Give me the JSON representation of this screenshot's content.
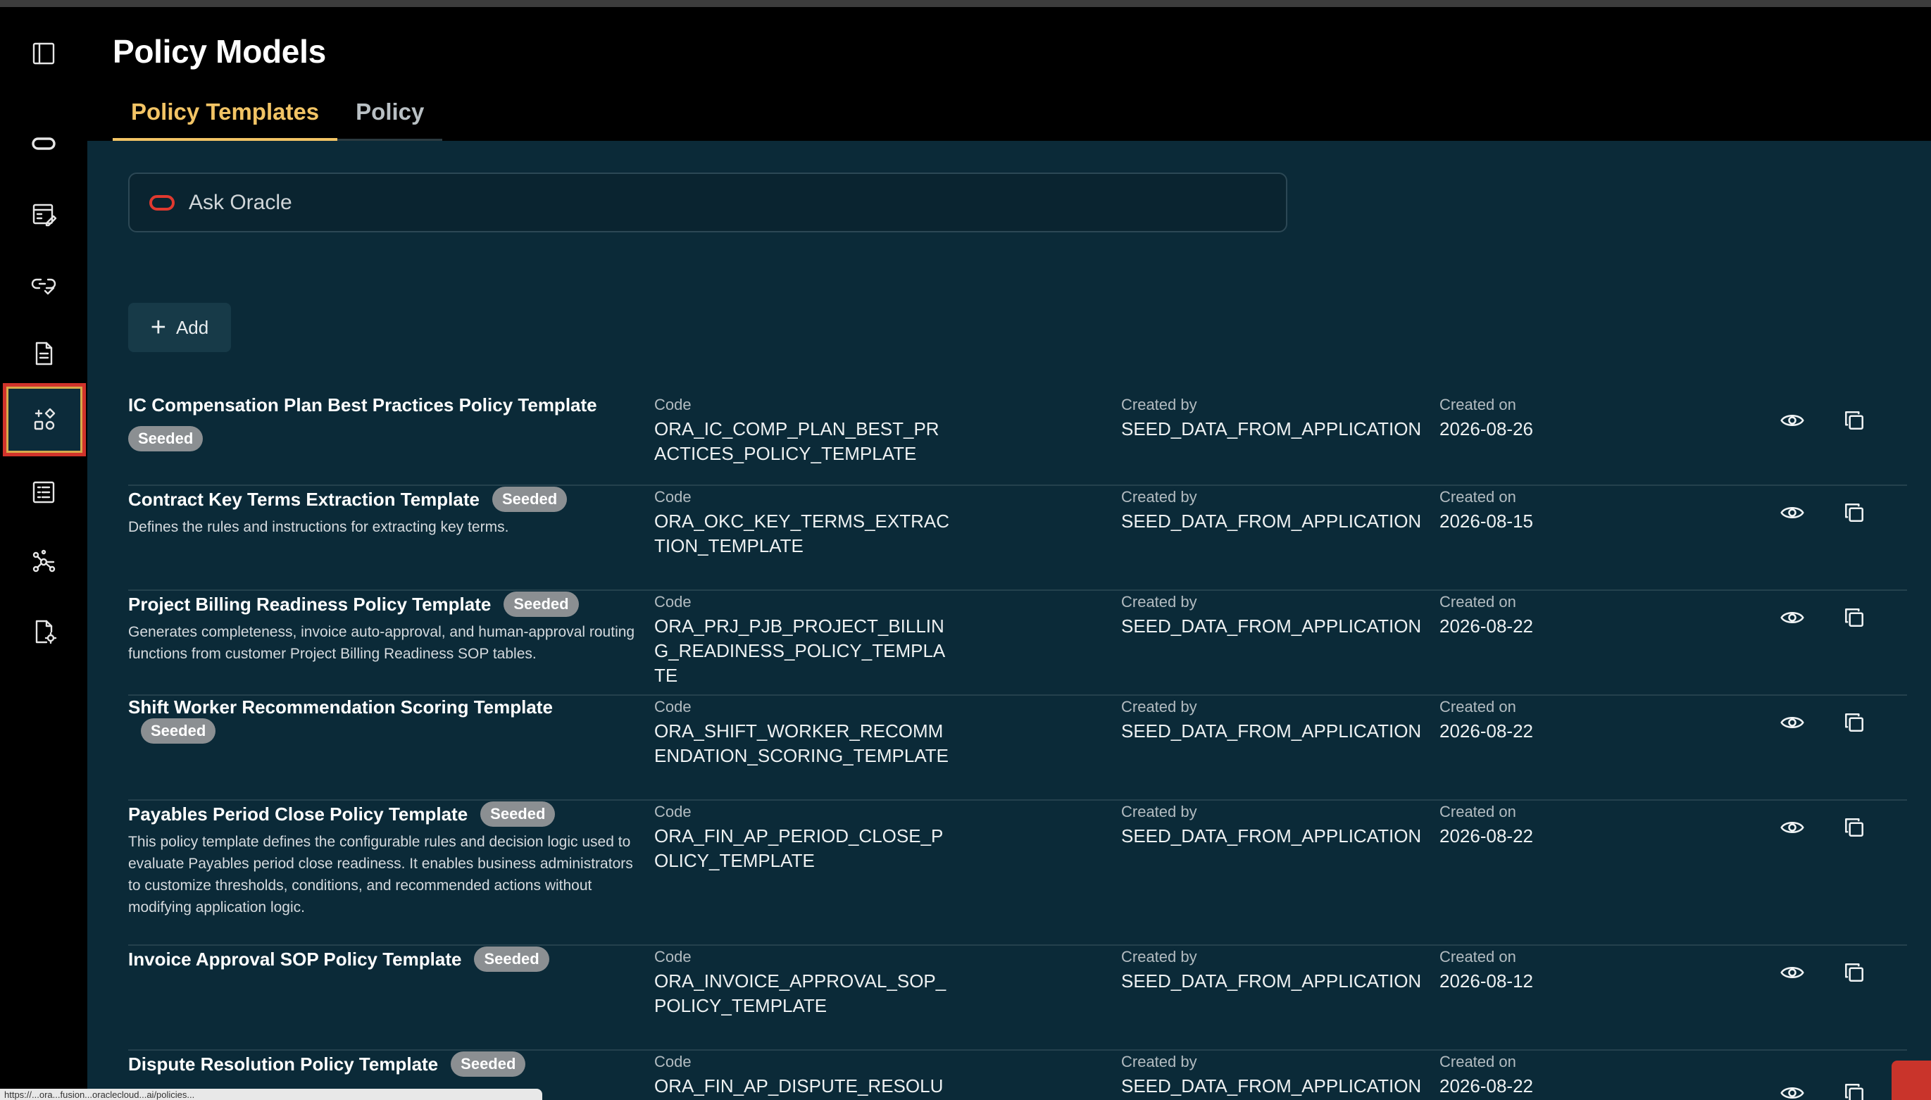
{
  "header": {
    "title": "Policy Models",
    "tabs": [
      {
        "label": "Policy Templates",
        "active": true
      },
      {
        "label": "Policy",
        "active": false
      }
    ]
  },
  "sidebar": {
    "items": [
      {
        "icon": "panel-toggle-icon"
      },
      {
        "icon": "oracle-logo-icon"
      },
      {
        "icon": "calendar-edit-icon"
      },
      {
        "icon": "link-check-icon"
      },
      {
        "icon": "document-icon"
      },
      {
        "icon": "policy-models-icon",
        "active": true
      },
      {
        "icon": "list-icon"
      },
      {
        "icon": "network-icon"
      },
      {
        "icon": "file-settings-icon"
      }
    ]
  },
  "search": {
    "placeholder": "Ask Oracle"
  },
  "toolbar": {
    "add_label": "Add"
  },
  "columns": {
    "code": "Code",
    "created_by": "Created by",
    "created_on": "Created on"
  },
  "badge_label": "Seeded",
  "rows": [
    {
      "name": "IC Compensation Plan Best Practices Policy Template",
      "description": "",
      "code": "ORA_IC_COMP_PLAN_BEST_PRACTICES_POLICY_TEMPLATE",
      "created_by": "SEED_DATA_FROM_APPLICATION",
      "created_on": "2026-08-26"
    },
    {
      "name": "Contract Key Terms Extraction Template",
      "description": "Defines the rules and instructions for extracting key terms.",
      "code": "ORA_OKC_KEY_TERMS_EXTRACTION_TEMPLATE",
      "created_by": "SEED_DATA_FROM_APPLICATION",
      "created_on": "2026-08-15"
    },
    {
      "name": "Project Billing Readiness Policy Template",
      "description": "Generates completeness, invoice auto-approval, and human-approval routing functions from customer Project Billing Readiness SOP tables.",
      "code": "ORA_PRJ_PJB_PROJECT_BILLING_READINESS_POLICY_TEMPLATE",
      "created_by": "SEED_DATA_FROM_APPLICATION",
      "created_on": "2026-08-22"
    },
    {
      "name": "Shift Worker Recommendation Scoring Template",
      "description": "",
      "code": "ORA_SHIFT_WORKER_RECOMMENDATION_SCORING_TEMPLATE",
      "created_by": "SEED_DATA_FROM_APPLICATION",
      "created_on": "2026-08-22"
    },
    {
      "name": "Payables Period Close Policy Template",
      "description": "This policy template defines the configurable rules and decision logic used to evaluate Payables period close readiness. It enables business administrators to customize thresholds, conditions, and recommended actions without modifying application logic.",
      "code": "ORA_FIN_AP_PERIOD_CLOSE_POLICY_TEMPLATE",
      "created_by": "SEED_DATA_FROM_APPLICATION",
      "created_on": "2026-08-22"
    },
    {
      "name": "Invoice Approval SOP Policy Template",
      "description": "",
      "code": "ORA_INVOICE_APPROVAL_SOP_POLICY_TEMPLATE",
      "created_by": "SEED_DATA_FROM_APPLICATION",
      "created_on": "2026-08-12"
    },
    {
      "name": "Dispute Resolution Policy Template",
      "description": "",
      "code": "ORA_FIN_AP_DISPUTE_RESOLUTI",
      "created_by": "SEED_DATA_FROM_APPLICATION",
      "created_on": "2026-08-22"
    }
  ],
  "status_bar": {
    "text": "https://...ora...fusion...oraclecloud...ai/policies..."
  },
  "colors": {
    "accent": "#f2c465",
    "background": "#0b2a38",
    "brand": "#d1332b"
  }
}
